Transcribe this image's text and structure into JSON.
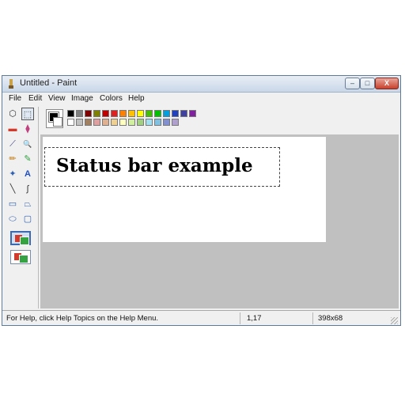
{
  "window": {
    "title": "Untitled - Paint",
    "controls": {
      "minimize": "–",
      "maximize": "□",
      "close": "X"
    }
  },
  "menubar": {
    "items": [
      "File",
      "Edit",
      "View",
      "Image",
      "Colors",
      "Help"
    ]
  },
  "toolbox": {
    "icons": [
      "free-select-icon",
      "rect-select-icon",
      "eraser-icon",
      "fill-bucket-icon",
      "color-picker-icon",
      "magnifier-icon",
      "pencil-icon",
      "brush-icon",
      "airbrush-icon",
      "text-icon",
      "line-icon",
      "curve-icon",
      "rectangle-icon",
      "polygon-icon",
      "ellipse-icon",
      "rounded-rect-icon"
    ],
    "selected": "rect-select-icon",
    "glyphs": [
      "⬡",
      "⬚",
      "▬",
      "⧫",
      "⟋",
      "🔍",
      "✏",
      "✎",
      "✦",
      "A",
      "╲",
      "∫",
      "▭",
      "⏢",
      "⬭",
      "▢"
    ]
  },
  "palette": {
    "foreground": "#000000",
    "background": "#ffffff",
    "row1": [
      "#000000",
      "#808080",
      "#800000",
      "#808000",
      "#c00000",
      "#e02020",
      "#ff8000",
      "#ffc000",
      "#ffff00",
      "#40c000",
      "#00c000",
      "#00a0e0",
      "#2040c0",
      "#4040a0",
      "#8020a0"
    ],
    "row2": [
      "#ffffff",
      "#c0c0c0",
      "#a08060",
      "#e0a0a0",
      "#e0b090",
      "#f0d090",
      "#ffffc0",
      "#d0f0a0",
      "#a0d080",
      "#a0e0f0",
      "#80c0e0",
      "#8090d0",
      "#b0a0d0"
    ]
  },
  "canvas": {
    "text": "Status bar example"
  },
  "statusbar": {
    "help_text": "For Help, click Help Topics on the Help Menu.",
    "cursor_position": "1,17",
    "selection_size": "398x68"
  }
}
